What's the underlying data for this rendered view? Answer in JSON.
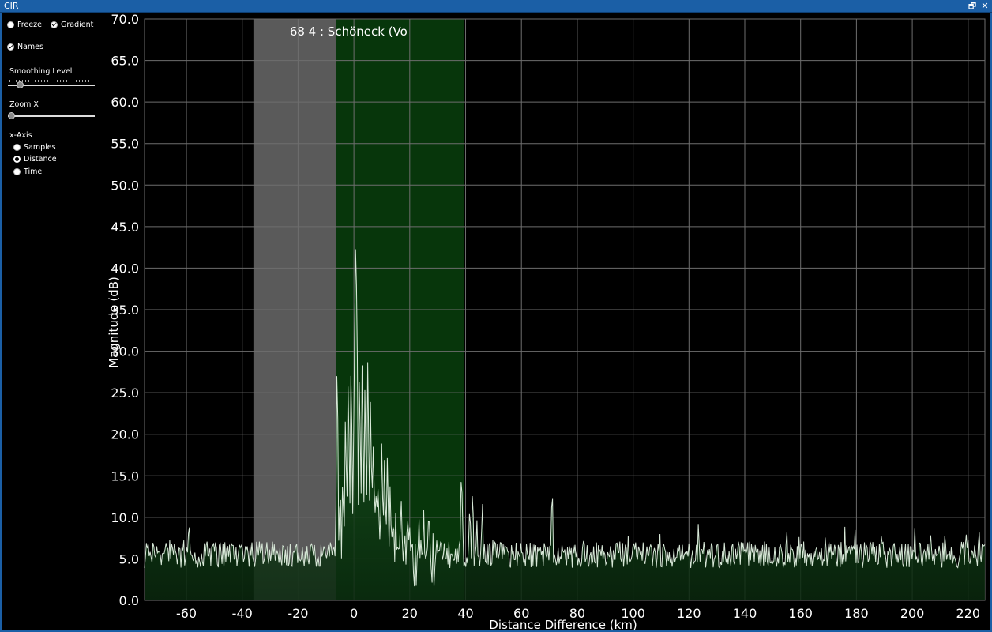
{
  "window": {
    "title": "CIR",
    "restore_glyph": "🗗",
    "close_glyph": "✕"
  },
  "controls": {
    "freeze": {
      "label": "Freeze",
      "checked": false
    },
    "gradient": {
      "label": "Gradient",
      "checked": true
    },
    "names": {
      "label": "Names",
      "checked": true
    },
    "smoothing_label": "Smoothing Level",
    "smoothing_value": 0.14,
    "zoom_label": "Zoom X",
    "zoom_value": 0.0,
    "xaxis_label": "x-Axis",
    "xaxis_options": [
      "Samples",
      "Distance",
      "Time"
    ],
    "xaxis_selected": "Distance"
  },
  "colors": {
    "background": "#000000",
    "gridline": "#6e6e6e",
    "signal_line": "#d8e8d8",
    "signal_fill_top": "#1f6e28",
    "signal_fill_bottom": "#0a280e",
    "gray_band": "#6a6a6a",
    "green_band": "#0c5a12",
    "titlebar": "#1b5fa6"
  },
  "chart_data": {
    "type": "area",
    "xlabel": "Distance Difference (km)",
    "ylabel": "Magnitude (dB)",
    "xlim": [
      -75,
      226
    ],
    "ylim": [
      0,
      70
    ],
    "xticks": [
      -60,
      -40,
      -20,
      0,
      20,
      40,
      60,
      80,
      100,
      120,
      140,
      160,
      180,
      200,
      220
    ],
    "yticks": [
      "0.0",
      "5.0",
      "10.0",
      "15.0",
      "20.0",
      "25.0",
      "30.0",
      "35.0",
      "40.0",
      "45.0",
      "50.0",
      "55.0",
      "60.0",
      "65.0",
      "70.0"
    ],
    "grid": true,
    "bands": [
      {
        "name": "gray-window",
        "x": [
          -36,
          -6.5
        ]
      },
      {
        "name": "green-window",
        "x": [
          -6.5,
          39.5
        ]
      }
    ],
    "annotation": {
      "text": "68 4 : Schöneck (Vo",
      "x": -23,
      "y": 68.5
    },
    "noise_floor_db": 5.5,
    "noise_amplitude_db": 1.6,
    "peaks": [
      {
        "x": -6,
        "y": 29.5
      },
      {
        "x": -4,
        "y": 15.0
      },
      {
        "x": -3,
        "y": 23.0
      },
      {
        "x": -2,
        "y": 27.5
      },
      {
        "x": -1,
        "y": 29.0
      },
      {
        "x": 0,
        "y": 22.0
      },
      {
        "x": 0.5,
        "y": 44.0
      },
      {
        "x": 1,
        "y": 40.0
      },
      {
        "x": 2,
        "y": 28.0
      },
      {
        "x": 3,
        "y": 30.0
      },
      {
        "x": 4,
        "y": 27.0
      },
      {
        "x": 5,
        "y": 29.5
      },
      {
        "x": 6,
        "y": 24.5
      },
      {
        "x": 7,
        "y": 20.0
      },
      {
        "x": 8,
        "y": 13.0
      },
      {
        "x": 9,
        "y": 11.0
      },
      {
        "x": 10,
        "y": 19.5
      },
      {
        "x": 11,
        "y": 17.5
      },
      {
        "x": 12,
        "y": 18.5
      },
      {
        "x": 13,
        "y": 14.0
      },
      {
        "x": 15,
        "y": 11.0
      },
      {
        "x": 17,
        "y": 12.5
      },
      {
        "x": 20,
        "y": 9.0
      },
      {
        "x": 23,
        "y": 7.5
      },
      {
        "x": 25,
        "y": 11.0
      },
      {
        "x": 27,
        "y": 9.5
      },
      {
        "x": 38.5,
        "y": 16.5
      },
      {
        "x": 41.5,
        "y": 12.0
      },
      {
        "x": 42.5,
        "y": 14.0
      },
      {
        "x": 44,
        "y": 11.0
      },
      {
        "x": 46,
        "y": 12.5
      },
      {
        "x": 71,
        "y": 14.5
      },
      {
        "x": 155,
        "y": 9.5
      },
      {
        "x": 224,
        "y": 8.5
      }
    ]
  }
}
